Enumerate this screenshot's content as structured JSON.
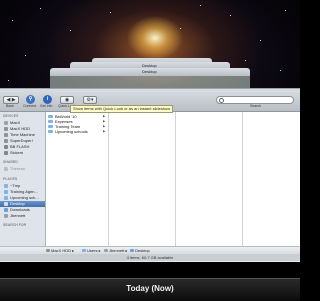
{
  "stack_window": {
    "title": "Desktop"
  },
  "toolbar": {
    "back_label": "Back",
    "view_label": "View",
    "connect_label": "Connect",
    "getinfo_label": "Get Info",
    "quicklook_label": "Quick Look",
    "action_label": "Action",
    "search_label": "Search",
    "tooltip": "Show items with Quick Look or as an instant slideshow"
  },
  "sidebar": {
    "devices_header": "DEVICES",
    "devices": [
      "MacX",
      "MacX HDD",
      "Time Machine",
      "SuperDuper!",
      "BB FLASH",
      "Sickem"
    ],
    "shared_header": "SHARED",
    "shared": [
      "Theresa"
    ],
    "places_header": "PLACES",
    "places": [
      "~Tmp",
      "Training Agen...",
      "Upcoming sch...",
      "Desktop",
      "Downloads",
      "Jbennett"
    ],
    "search_header": "SEARCH FOR"
  },
  "column1": {
    "items": [
      "BbWorld '10",
      "Expenses",
      "Training Team",
      "Upcoming schools"
    ]
  },
  "pathbar": {
    "items": [
      "MacX HDD",
      "Users",
      "Jbennett",
      "Desktop"
    ]
  },
  "status": "4 items, 60.7 GB available",
  "timeline": {
    "title": "Today (Now)"
  },
  "colors": {
    "selection": "#3f6fac",
    "folder": "#7fb2e8",
    "tooltip_bg": "#fffbc8"
  }
}
